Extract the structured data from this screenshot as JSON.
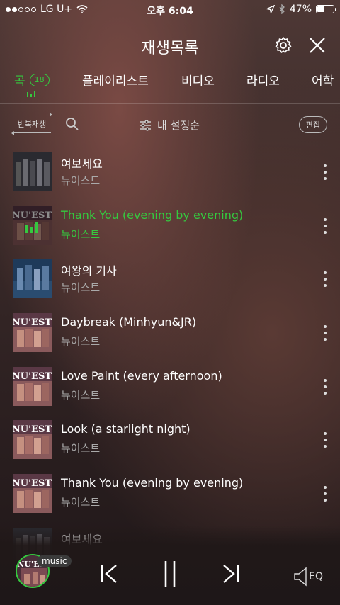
{
  "status_bar": {
    "carrier": "LG U+",
    "time": "오후 6:04",
    "battery": "47%",
    "battery_level": 0.47
  },
  "header": {
    "title": "재생목록"
  },
  "tabs": [
    {
      "label": "곡",
      "badge": "18",
      "active": true
    },
    {
      "label": "플레이리스트"
    },
    {
      "label": "비디오"
    },
    {
      "label": "라디오"
    },
    {
      "label": "어학"
    }
  ],
  "toolbar": {
    "repeat_label": "반복재생",
    "sort_label": "내 설정순",
    "edit_label": "편집"
  },
  "songs": [
    {
      "title": "여보세요",
      "artist": "뉴이스트",
      "active": false,
      "cover": "dark-group"
    },
    {
      "title": "Thank You (evening by evening)",
      "artist": "뉴이스트",
      "active": true,
      "cover": "nuest"
    },
    {
      "title": "여왕의 기사",
      "artist": "뉴이스트",
      "active": false,
      "cover": "blue-group"
    },
    {
      "title": "Daybreak (Minhyun&JR)",
      "artist": "뉴이스트",
      "active": false,
      "cover": "nuest"
    },
    {
      "title": "Love Paint (every afternoon)",
      "artist": "뉴이스트",
      "active": false,
      "cover": "nuest"
    },
    {
      "title": "Look (a starlight night)",
      "artist": "뉴이스트",
      "active": false,
      "cover": "nuest"
    },
    {
      "title": "Thank You (evening by evening)",
      "artist": "뉴이스트",
      "active": false,
      "cover": "nuest"
    },
    {
      "title": "여보세요",
      "artist": "",
      "active": false,
      "cover": "dark-group"
    }
  ],
  "player": {
    "badge": "music",
    "eq_label": "EQ"
  },
  "colors": {
    "accent": "#35c93f"
  }
}
